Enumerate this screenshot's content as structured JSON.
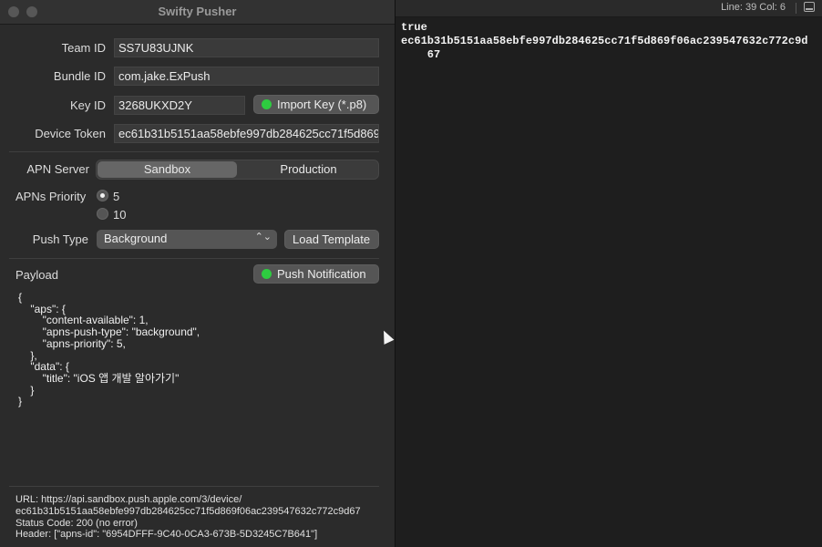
{
  "window": {
    "title": "Swifty Pusher"
  },
  "form": {
    "team_id": {
      "label": "Team ID",
      "value": "SS7U83UJNK"
    },
    "bundle_id": {
      "label": "Bundle ID",
      "value": "com.jake.ExPush"
    },
    "key_id": {
      "label": "Key ID",
      "value": "3268UKXD2Y"
    },
    "import_key_label": "Import Key (*.p8)",
    "device_token": {
      "label": "Device Token",
      "value": "ec61b31b5151aa58ebfe997db284625cc71f5d869f06ac239547632c772c9d67"
    },
    "apn_server": {
      "label": "APN Server",
      "options": [
        "Sandbox",
        "Production"
      ],
      "selected": "Sandbox"
    },
    "priority": {
      "label": "APNs Priority",
      "options": [
        "5",
        "10"
      ],
      "selected": "5"
    },
    "push_type": {
      "label": "Push Type",
      "value": "Background"
    },
    "load_template_label": "Load Template",
    "payload_label": "Payload",
    "push_notification_label": "Push Notification",
    "payload_text": "{\n    \"aps\": {\n        \"content-available\": 1,\n        \"apns-push-type\": \"background\",\n        \"apns-priority\": 5,\n    },\n    \"data\": {\n        \"title\": \"iOS 앱 개발 알아가기\"\n    }\n}"
  },
  "status": {
    "url_line1": "URL: https://api.sandbox.push.apple.com/3/device/",
    "url_line2": "ec61b31b5151aa58ebfe997db284625cc71f5d869f06ac239547632c772c9d67",
    "code": "Status Code: 200 (no error)",
    "header": "Header: [\"apns-id\": \"6954DFFF-9C40-0CA3-673B-5D3245C7B641\"]"
  },
  "editor": {
    "line_col": "Line: 39  Col: 6",
    "text": "true\nec61b31b5151aa58ebfe997db284625cc71f5d869f06ac239547632c772c9d\n    67"
  },
  "colors": {
    "status_dot": "#2ecc40"
  }
}
